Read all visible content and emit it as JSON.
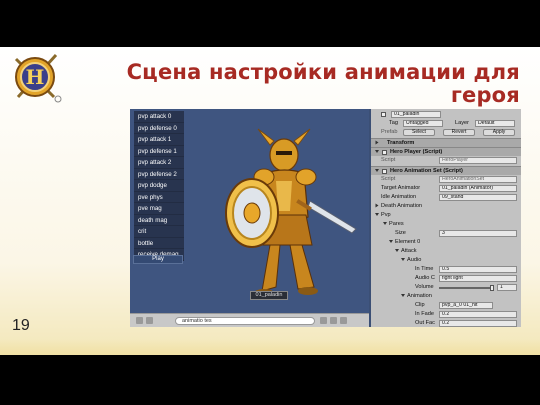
{
  "slide": {
    "title": "Сцена настройки анимации для героя",
    "page_number": "19"
  },
  "game_view": {
    "menu_items": [
      "pvp attack 0",
      "pvp defense 0",
      "pvp attack 1",
      "pvp defense 1",
      "pvp attack 2",
      "pvp defense 2",
      "pvp dodge",
      "pve phys",
      "pve mag",
      "death mag",
      "crit",
      "bottle",
      "receive demag"
    ],
    "play_label": "Play",
    "character_label": "01_paladin",
    "search_value": "animatio tes"
  },
  "inspector": {
    "object_name": "01_paladin",
    "tag_label": "Tag",
    "tag_value": "Untagged",
    "layer_label": "Layer",
    "layer_value": "Default",
    "prefab_label": "Prefab",
    "select_label": "Select",
    "revert_label": "Revert",
    "apply_label": "Apply",
    "transform_label": "Transform",
    "hero_player_label": "Hero Player (Script)",
    "script_label": "Script",
    "hero_player_script": "HeroPlayer",
    "hero_anim_label": "Hero Animation Set (Script)",
    "hero_anim_script": "HeroAnimationSet",
    "target_animator_label": "Target Animator",
    "target_animator_value": "01_paladin (Animator)",
    "idle_animation_label": "Idle Animation",
    "idle_animation_value": "09_stand",
    "death_animation_label": "Death Animation",
    "pvp_label": "Pvp",
    "pares_label": "Pares",
    "size_label": "Size",
    "size_value": "3",
    "element_label": "Element 0",
    "attack_label": "Attack",
    "audio_label": "Audio",
    "in_time_label": "In Time",
    "in_time_value": "0.5",
    "audio_clip_label": "Audio C",
    "audio_clip_value": "fight light",
    "volume_label": "Volume",
    "volume_value": "1",
    "animation_label": "Animation",
    "clip_label": "Clip",
    "clip_value": "pvp_a_0 01_hit",
    "in_fade_label": "In Fade",
    "in_fade_value": "0.2",
    "out_fade_label": "Out Fac",
    "out_fade_value": "0.2"
  },
  "colors": {
    "title": "#a72a23",
    "viewport_bg": "#3f5580",
    "inspector_bg": "#c2c2c2"
  }
}
